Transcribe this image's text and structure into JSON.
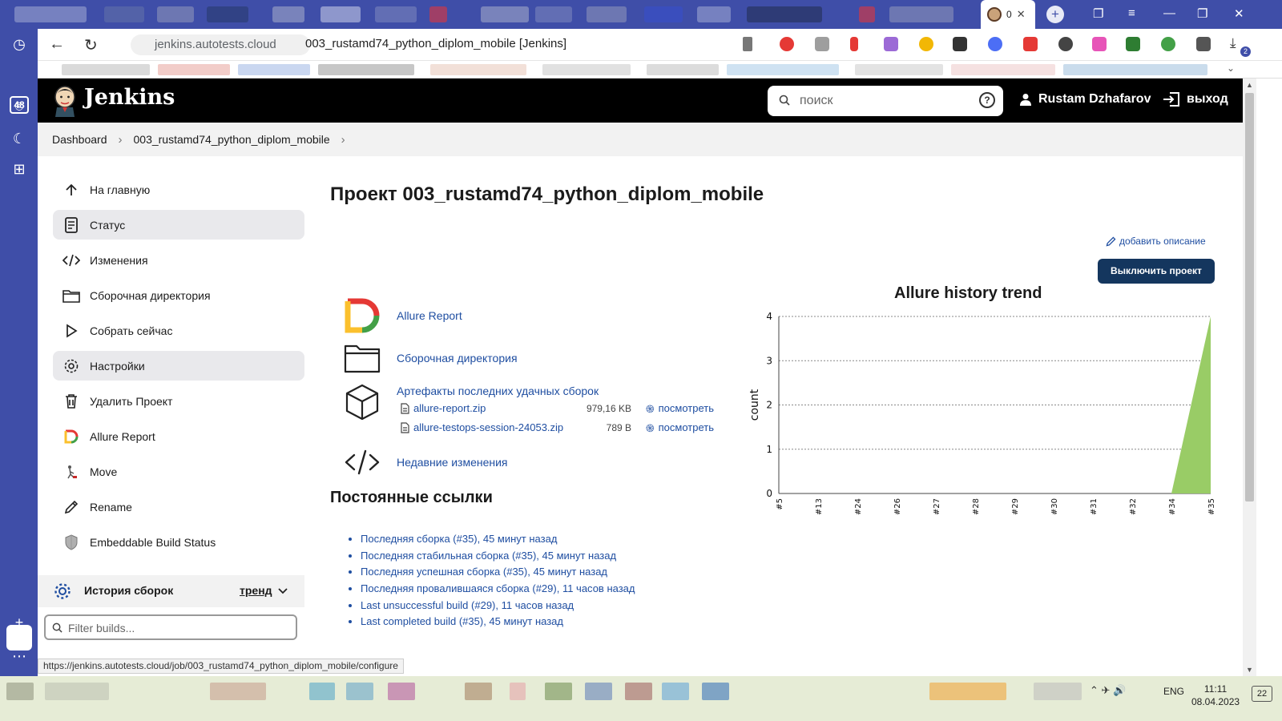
{
  "browser": {
    "active_tab_label": "0",
    "rail_badge": "48",
    "url": "jenkins.autotests.cloud",
    "page_title": "003_rustamd74_python_diplom_mobile [Jenkins]",
    "download_badge": "2"
  },
  "jenkins": {
    "brand": "Jenkins",
    "search_placeholder": "поиск",
    "user_name": "Rustam Dzhafarov",
    "logout_label": "выход"
  },
  "breadcrumbs": [
    "Dashboard",
    "003_rustamd74_python_diplom_mobile"
  ],
  "sidebar": {
    "items": [
      {
        "label": "На главную",
        "icon": "arrow-up-icon"
      },
      {
        "label": "Статус",
        "icon": "document-icon",
        "active": true
      },
      {
        "label": "Изменения",
        "icon": "code-icon"
      },
      {
        "label": "Сборочная директория",
        "icon": "folder-icon"
      },
      {
        "label": "Собрать сейчас",
        "icon": "play-icon"
      },
      {
        "label": "Настройки",
        "icon": "gear-icon",
        "active": true
      },
      {
        "label": "Удалить Проект",
        "icon": "trash-icon"
      },
      {
        "label": "Allure Report",
        "icon": "allure-icon"
      },
      {
        "label": "Move",
        "icon": "move-icon"
      },
      {
        "label": "Rename",
        "icon": "pencil-icon"
      },
      {
        "label": "Embeddable Build Status",
        "icon": "shield-icon"
      }
    ],
    "history_title": "История сборок",
    "trend_label": "тренд",
    "filter_placeholder": "Filter builds..."
  },
  "main": {
    "title": "Проект 003_rustamd74_python_diplom_mobile",
    "add_description": "добавить описание",
    "disable_button": "Выключить проект",
    "actions": {
      "allure_report": "Allure Report",
      "workspace": "Сборочная директория",
      "artifacts": "Артефакты последних удачных сборок",
      "recent_changes": "Недавние изменения"
    },
    "artifacts": [
      {
        "name": "allure-report.zip",
        "size": "979,16 KB",
        "view": "посмотреть"
      },
      {
        "name": "allure-testops-session-24053.zip",
        "size": "789 B",
        "view": "посмотреть"
      }
    ],
    "permalinks_title": "Постоянные ссылки",
    "permalinks": [
      "Последняя сборка (#35), 45 минут назад",
      "Последняя стабильная сборка (#35), 45 минут назад",
      "Последняя успешная сборка (#35), 45 минут назад",
      "Последняя провалившаяся сборка (#29), 11 часов назад",
      "Last unsuccessful build (#29), 11 часов назад",
      "Last completed build (#35), 45 минут назад"
    ]
  },
  "chart_data": {
    "type": "area",
    "title": "Allure history trend",
    "xlabel": "",
    "ylabel": "count",
    "categories": [
      "#5",
      "#13",
      "#24",
      "#26",
      "#27",
      "#28",
      "#29",
      "#30",
      "#31",
      "#32",
      "#34",
      "#35"
    ],
    "series": [
      {
        "values": [
          0,
          0,
          0,
          0,
          0,
          0,
          0,
          0,
          0,
          0,
          0,
          4
        ],
        "color": "#99cc66"
      }
    ],
    "ylim": [
      0,
      4
    ],
    "yticks": [
      0,
      1,
      2,
      3,
      4
    ],
    "grid": true
  },
  "status_bar_url": "https://jenkins.autotests.cloud/job/003_rustamd74_python_diplom_mobile/configure",
  "taskbar": {
    "lang": "ENG",
    "time": "11:11",
    "date": "08.04.2023",
    "notifications": "22"
  }
}
